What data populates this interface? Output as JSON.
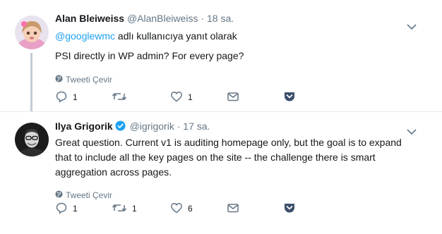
{
  "tweets": [
    {
      "author_name": "Alan Bleiweiss",
      "handle": "@AlanBleiweiss",
      "separator": "·",
      "time": "18 sa.",
      "reply_to_handle": "@googlewmc",
      "reply_to_suffix": " adlı kullanıcıya yanıt olarak",
      "text": "PSI directly in WP admin? For every page?",
      "translate_label": "Tweeti Çevir",
      "counts": {
        "reply": "1",
        "retweet": "",
        "like": "1"
      }
    },
    {
      "author_name": "Ilya Grigorik",
      "handle": "@igrigorik",
      "separator": "·",
      "time": "17 sa.",
      "text": "Great question. Current v1 is auditing homepage only, but the goal is to expand that to include all the key pages on the site -- the challenge there is smart aggregation across pages.",
      "translate_label": "Tweeti Çevir",
      "counts": {
        "reply": "1",
        "retweet": "1",
        "like": "6"
      }
    }
  ],
  "icons": {
    "reply": "reply-icon",
    "retweet": "retweet-icon",
    "like": "heart-icon",
    "dm": "envelope-icon",
    "save": "pocket-icon",
    "translate": "globe-icon",
    "verified": "verified-badge-icon",
    "caret": "chevron-down-icon"
  },
  "colors": {
    "text": "#14171a",
    "secondary": "#657786",
    "link": "#1da1f2",
    "verified": "#1da1f2",
    "save_icon": "#3b4f6b"
  }
}
